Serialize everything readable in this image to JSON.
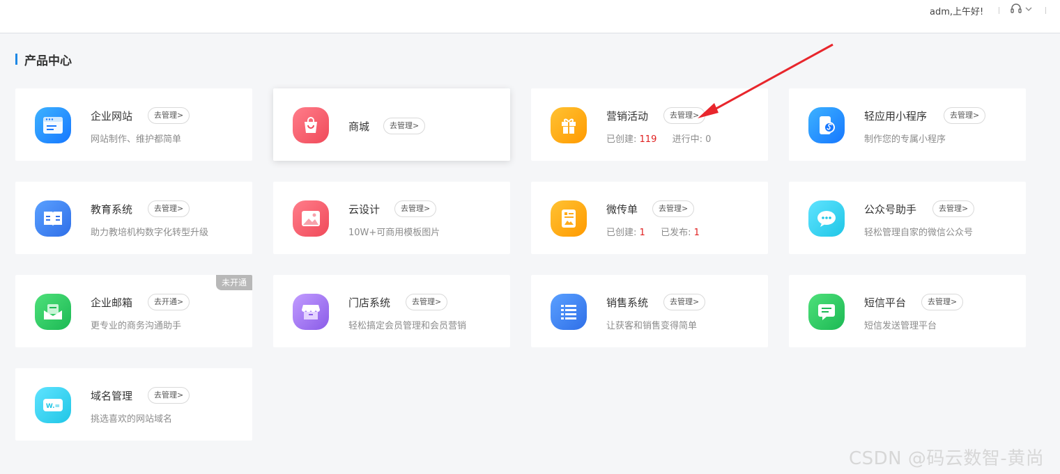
{
  "header": {
    "greeting": "adm,上午好!"
  },
  "section": {
    "title": "产品中心"
  },
  "manage_label": "去管理>",
  "open_label": "去开通>",
  "cards": {
    "website": {
      "title": "企业网站",
      "desc": "网站制作、维护都简单"
    },
    "mall": {
      "title": "商城"
    },
    "marketing": {
      "title": "营销活动",
      "stat1_label": "已创建:",
      "stat1_value": "119",
      "stat2_label": "进行中:",
      "stat2_value": "0"
    },
    "miniapp": {
      "title": "轻应用小程序",
      "desc": "制作您的专属小程序"
    },
    "edu": {
      "title": "教育系统",
      "desc": "助力教培机构数字化转型升级"
    },
    "design": {
      "title": "云设计",
      "desc": "10W+可商用模板图片"
    },
    "flyer": {
      "title": "微传单",
      "stat1_label": "已创建:",
      "stat1_value": "1",
      "stat2_label": "已发布:",
      "stat2_value": "1"
    },
    "mp": {
      "title": "公众号助手",
      "desc": "轻松管理自家的微信公众号"
    },
    "mail": {
      "title": "企业邮箱",
      "desc": "更专业的商务沟通助手",
      "badge": "未开通"
    },
    "store": {
      "title": "门店系统",
      "desc": "轻松搞定会员管理和会员营销"
    },
    "sales": {
      "title": "销售系统",
      "desc": "让获客和销售变得简单"
    },
    "sms": {
      "title": "短信平台",
      "desc": "短信发送管理平台"
    },
    "domain": {
      "title": "域名管理",
      "desc": "挑选喜欢的网站域名"
    }
  },
  "watermark": "CSDN @码云数智-黄尚",
  "icons": {
    "website": "browser-icon",
    "mall": "shopping-bag-icon",
    "marketing": "gift-icon",
    "miniapp": "mini-program-icon",
    "edu": "book-icon",
    "design": "image-icon",
    "flyer": "flyer-icon",
    "mp": "wechat-icon",
    "mail": "mail-icon",
    "store": "store-icon",
    "sales": "list-icon",
    "sms": "chat-icon",
    "domain": "domain-icon"
  },
  "colors": {
    "accent": "#1e88e5",
    "count": "#e02020",
    "arrow": "#e8262c"
  }
}
